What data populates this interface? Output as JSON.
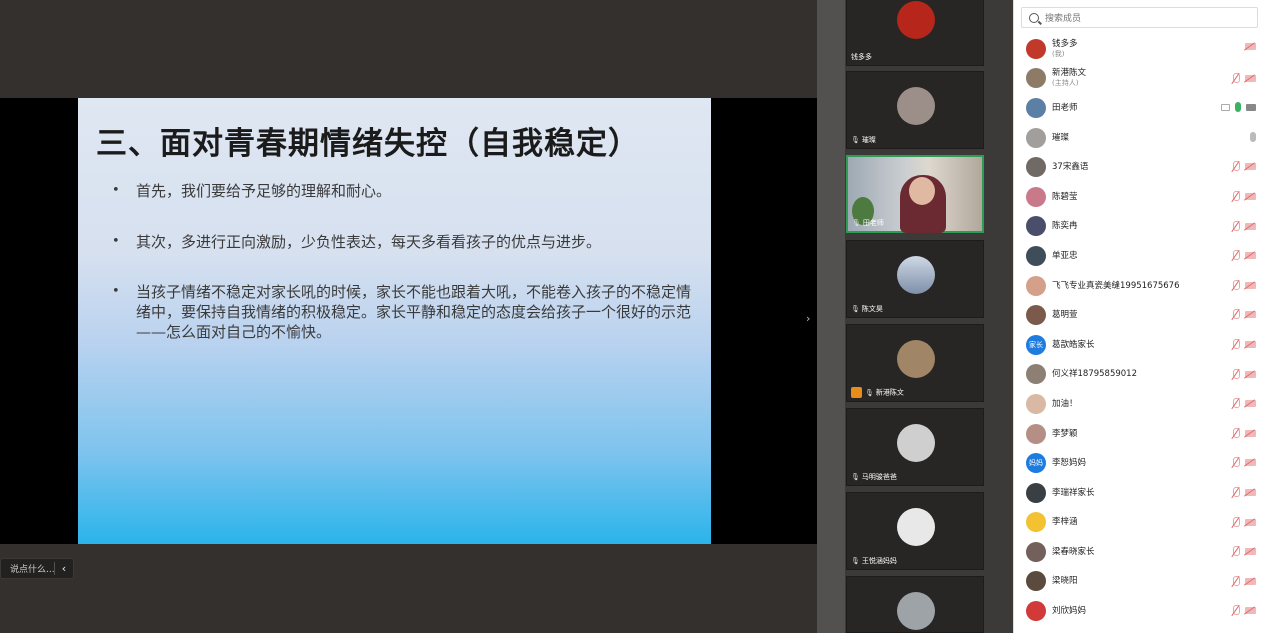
{
  "slide": {
    "title": "三、面对青春期情绪失控（自我稳定）",
    "bullets": [
      "首先，我们要给予足够的理解和耐心。",
      "其次，多进行正向激励，少负性表达，每天多看看孩子的优点与进步。",
      "当孩子情绪不稳定对家长吼的时候，家长不能也跟着大吼，不能卷入孩子的不稳定情绪中，要保持自我情绪的积极稳定。家长平静和稳定的态度会给孩子一个很好的示范——怎么面对自己的不愉快。"
    ],
    "bullet_symbol": "•"
  },
  "chat_input": {
    "placeholder": "说点什么...",
    "collapse_glyph": "‹"
  },
  "strip_handle_glyph": "›",
  "video_tiles": [
    {
      "name": "钱多多",
      "mic": "",
      "color": "#b6261a"
    },
    {
      "name": "璀璨",
      "mic": "🎙",
      "color": "#9c8f8a"
    },
    {
      "name": "田老师",
      "mic": "🎙",
      "color": ""
    },
    {
      "name": "陈文昊",
      "mic": "🎙",
      "color": "#7e8fa8"
    },
    {
      "name": "新港陈文",
      "mic": "🎙",
      "color": "#a08566"
    },
    {
      "name": "马明骏爸爸",
      "mic": "🎙",
      "color": "#cfcfcf"
    },
    {
      "name": "王悦涵妈妈",
      "mic": "🎙",
      "color": "#e8e8e8"
    },
    {
      "name": "",
      "mic": "",
      "color": "#9ea3a8"
    }
  ],
  "search": {
    "placeholder": "搜索成员"
  },
  "members": [
    {
      "name": "钱多多",
      "sub": "(我)",
      "avatar_color": "#c0392b",
      "avatar_text": "",
      "state": "cam-only"
    },
    {
      "name": "新港陈文",
      "sub": "(主持人)",
      "avatar_color": "#8d7b68",
      "avatar_text": "",
      "state": "off"
    },
    {
      "name": "田老师",
      "sub": "",
      "avatar_color": "#5c7fa6",
      "avatar_text": "",
      "state": "on"
    },
    {
      "name": "璀璨",
      "sub": "",
      "avatar_color": "#a29e9b",
      "avatar_text": "",
      "state": "mic-gray"
    },
    {
      "name": "37宋鑫语",
      "sub": "",
      "avatar_color": "#6f6a66",
      "avatar_text": "",
      "state": "off"
    },
    {
      "name": "陈碧莹",
      "sub": "",
      "avatar_color": "#c97a8a",
      "avatar_text": "",
      "state": "off"
    },
    {
      "name": "陈奕冉",
      "sub": "",
      "avatar_color": "#4a4e6a",
      "avatar_text": "",
      "state": "off"
    },
    {
      "name": "单亚忠",
      "sub": "",
      "avatar_color": "#3f4c5a",
      "avatar_text": "",
      "state": "off"
    },
    {
      "name": "飞飞专业真瓷美缝19951675676",
      "sub": "",
      "avatar_color": "#d4a08a",
      "avatar_text": "",
      "state": "off"
    },
    {
      "name": "葛明萱",
      "sub": "",
      "avatar_color": "#7b5a4c",
      "avatar_text": "",
      "state": "off"
    },
    {
      "name": "葛歆皓家长",
      "sub": "",
      "avatar_color": "#1e7be0",
      "avatar_text": "家长",
      "state": "off"
    },
    {
      "name": "何义祥18795859012",
      "sub": "",
      "avatar_color": "#8c7f74",
      "avatar_text": "",
      "state": "off"
    },
    {
      "name": "加油！",
      "sub": "",
      "avatar_color": "#d9b9a3",
      "avatar_text": "",
      "state": "off"
    },
    {
      "name": "李梦颖",
      "sub": "",
      "avatar_color": "#b58f86",
      "avatar_text": "",
      "state": "off"
    },
    {
      "name": "李恕妈妈",
      "sub": "",
      "avatar_color": "#1e7be0",
      "avatar_text": "妈妈",
      "state": "off"
    },
    {
      "name": "李瑞祥家长",
      "sub": "",
      "avatar_color": "#3a3f44",
      "avatar_text": "",
      "state": "off"
    },
    {
      "name": "李梓涵",
      "sub": "",
      "avatar_color": "#f2c230",
      "avatar_text": "",
      "state": "off"
    },
    {
      "name": "梁春晓家长",
      "sub": "",
      "avatar_color": "#73605a",
      "avatar_text": "",
      "state": "off"
    },
    {
      "name": "梁晓阳",
      "sub": "",
      "avatar_color": "#5b4a3e",
      "avatar_text": "",
      "state": "off"
    },
    {
      "name": "刘欣妈妈",
      "sub": "",
      "avatar_color": "#d23a3a",
      "avatar_text": "",
      "state": "off"
    }
  ]
}
